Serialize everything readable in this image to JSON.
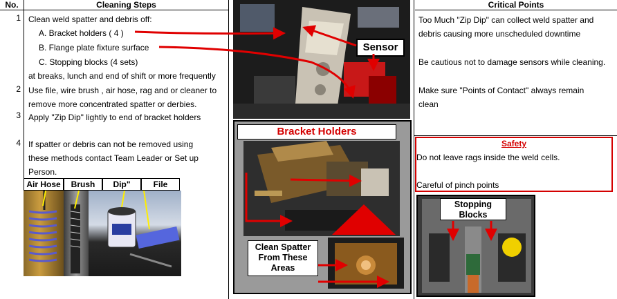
{
  "header": {
    "no": "No.",
    "steps": "Cleaning Steps",
    "critical": "Critical Points"
  },
  "steps": {
    "n1": "1",
    "s1": "Clean weld spatter and debris off:",
    "a": "A. Bracket holders ( 4 )",
    "b": "B. Flange plate fixture surface",
    "c": "C. Stopping blocks (4 sets)",
    "s1b": "at breaks, lunch and end of shift or more frequently",
    "n2": "2",
    "s2a": "Use file, wire brush , air hose, rag and or cleaner to",
    "s2b": "remove more concentrated spatter or derbies.",
    "n3": "3",
    "s3": "Apply \"Zip Dip\" lightly to end of bracket holders",
    "n4": "4",
    "s4a": "If spatter or debris can not be removed using",
    "s4b": "these methods contact Team Leader or Set up",
    "s4c": "Person."
  },
  "tools": [
    "Air Hose",
    "Brush",
    "Dip\"",
    "File"
  ],
  "photo_labels": {
    "sensor": "Sensor",
    "bracket_holders": "Bracket Holders",
    "clean_spatter": "Clean Spatter From These Areas",
    "stopping_blocks": "Stopping Blocks"
  },
  "critical": {
    "p1a": "Too Much \"Zip Dip\" can collect weld spatter and",
    "p1b": "debris causing more unscheduled downtime",
    "p2": "Be cautious not to damage sensors while cleaning.",
    "p3a": "Make sure \"Points of Contact\" always remain",
    "p3b": "clean",
    "safety_title": "Safety",
    "safety1": "Do not leave rags inside the weld cells.",
    "safety2": "Careful of pinch points"
  },
  "colors": {
    "accent_red": "#e00000",
    "safety_red": "#d40000"
  }
}
